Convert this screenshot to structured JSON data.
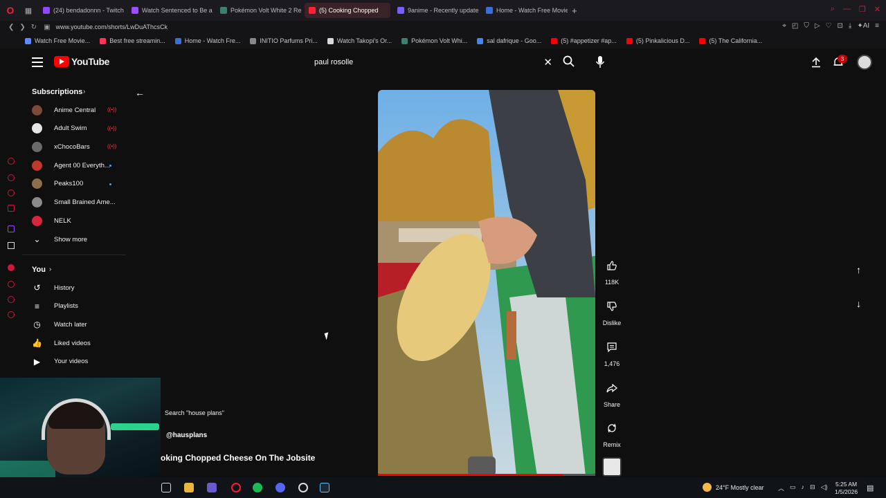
{
  "browser": {
    "tabs": [
      {
        "title": "(24) bendadonnn - Twitch",
        "color": "#9146ff",
        "active": false
      },
      {
        "title": "Watch Sentenced to Be a Hero",
        "color": "#9b4dff",
        "active": false
      },
      {
        "title": "Pokémon Volt White 2 Re",
        "color": "#3b7f6e",
        "active": false
      },
      {
        "title": "(5) Cooking Chopped",
        "color": "#ff2233",
        "active": true
      },
      {
        "title": "9anime - Recently update",
        "color": "#7a5cff",
        "active": false
      },
      {
        "title": "Home - Watch Free Movie",
        "color": "#3a6fd8",
        "active": false
      }
    ],
    "url": "www.youtube.com/shorts/LwDuAThcsCk",
    "bookmarks": [
      {
        "label": "Watch Free Movie...",
        "color": "#5b8cff"
      },
      {
        "label": "Best free streamin...",
        "color": "#ff3355"
      },
      {
        "label": "Home - Watch Fre...",
        "color": "#3a6fd8"
      },
      {
        "label": "INITIO Parfums Pri...",
        "color": "#888888"
      },
      {
        "label": "Watch Takopi's Or...",
        "color": "#d9d9d9"
      },
      {
        "label": "Pokémon Volt Whi...",
        "color": "#3b7f6e"
      },
      {
        "label": "sal dafrique - Goo...",
        "color": "#4285f4"
      },
      {
        "label": "(5) #appetizer #ap...",
        "color": "#ff0000"
      },
      {
        "label": "(5) Pinkalicious D...",
        "color": "#ff0000"
      },
      {
        "label": "(5) The California...",
        "color": "#ff0000"
      }
    ]
  },
  "youtube": {
    "logo_text": "YouTube",
    "search_query": "paul rosolle",
    "notification_count": "3",
    "sidebar": {
      "subscriptions_title": "Subscriptions",
      "subscriptions": [
        {
          "name": "Anime Central",
          "status": "live",
          "color": "#7a4a3a"
        },
        {
          "name": "Adult Swim",
          "status": "live",
          "color": "#e6e6e6"
        },
        {
          "name": "xChocoBars",
          "status": "live",
          "color": "#6a6a6a"
        },
        {
          "name": "Agent 00 Everyth...",
          "status": "new",
          "color": "#c0392b"
        },
        {
          "name": "Peaks100",
          "status": "new",
          "color": "#8d6e4a"
        },
        {
          "name": "Small Brained Ame...",
          "status": "",
          "color": "#8a8a8a"
        },
        {
          "name": "NELK",
          "status": "",
          "color": "#d7263d"
        }
      ],
      "show_more": "Show more",
      "you_title": "You",
      "you_items": [
        {
          "label": "History",
          "icon": "history-icon",
          "glyph": "↺"
        },
        {
          "label": "Playlists",
          "icon": "playlists-icon",
          "glyph": "≡"
        },
        {
          "label": "Watch later",
          "icon": "watch-later-icon",
          "glyph": "◷"
        },
        {
          "label": "Liked videos",
          "icon": "thumbs-up-icon",
          "glyph": "👍"
        },
        {
          "label": "Your videos",
          "icon": "your-videos-icon",
          "glyph": "▶"
        }
      ]
    },
    "short": {
      "search_suggestion": "Search \"house plans\"",
      "channel": "@hausplans",
      "title": "oking Chopped Cheese On The Jobsite",
      "progress": 0.85
    },
    "actions": {
      "likes": "118K",
      "dislike": "Dislike",
      "comments": "1,476",
      "share": "Share",
      "remix": "Remix"
    }
  },
  "taskbar": {
    "weather": "24°F  Mostly clear",
    "time": "5:25 AM",
    "date": "1/5/2026"
  }
}
